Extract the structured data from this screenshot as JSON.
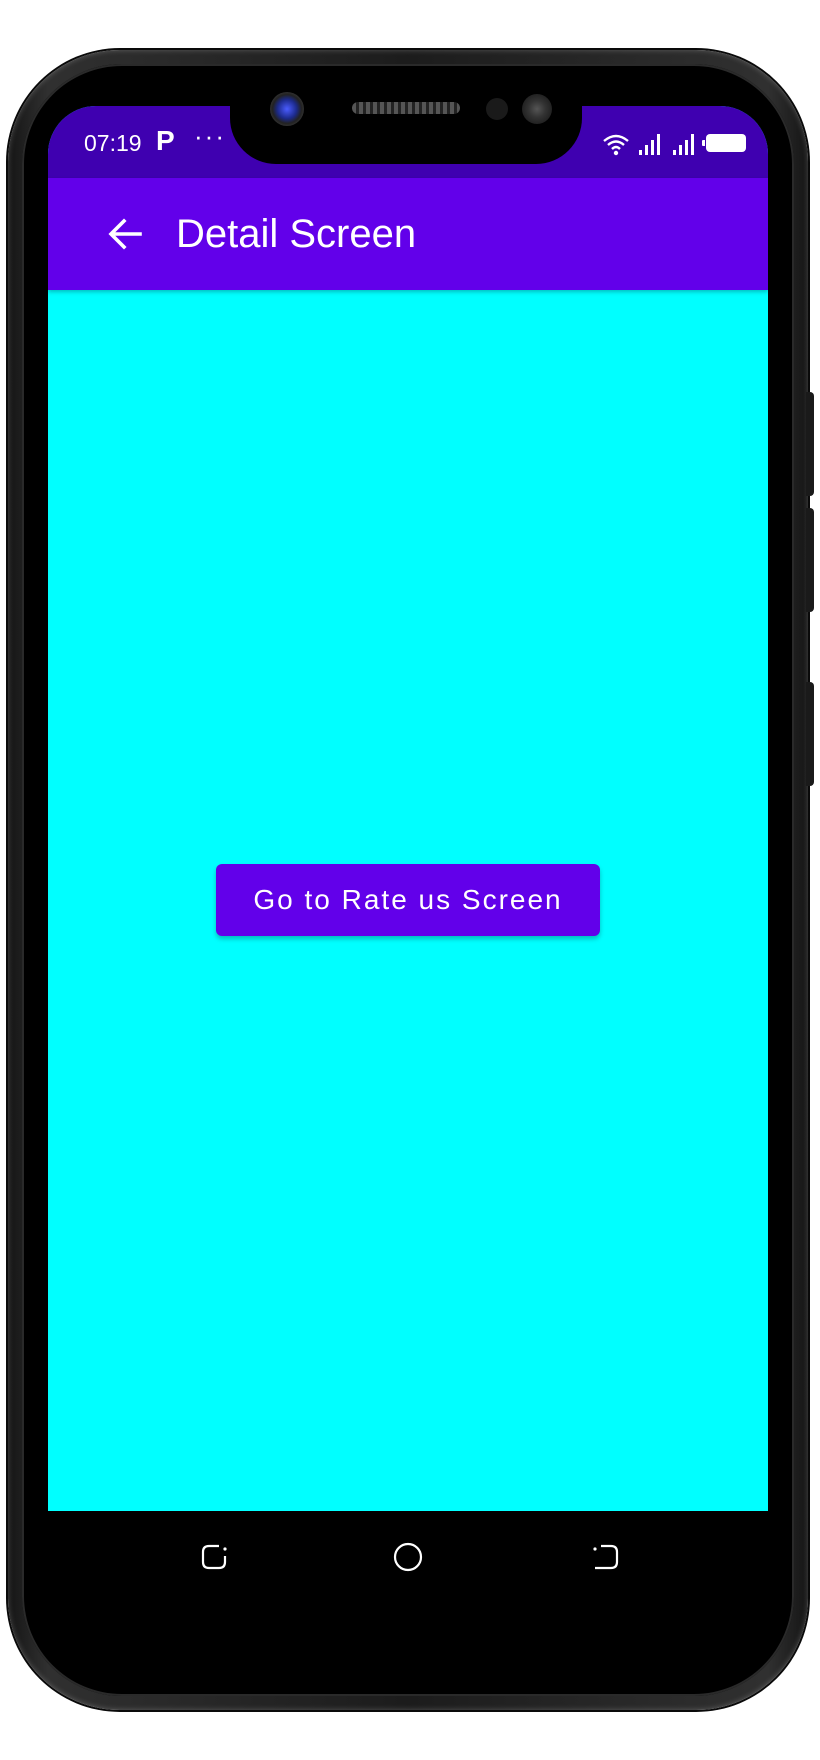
{
  "status_bar": {
    "time": "07:19",
    "notification_icon_letter": "P",
    "overflow_dots": "···",
    "icons": [
      "wifi-icon",
      "signal-icon",
      "signal-icon",
      "battery-icon"
    ]
  },
  "app_bar": {
    "title": "Detail Screen",
    "back_icon": "arrow-left-icon"
  },
  "main": {
    "button_label": "Go to Rate us Screen"
  },
  "nav_bar": {
    "icons": [
      "recents-icon",
      "home-icon",
      "back-icon"
    ]
  },
  "colors": {
    "status_bar": "#3f00b0",
    "app_bar": "#6200ea",
    "background": "#00ffff",
    "button": "#6200ea",
    "text_on_primary": "#ffffff"
  }
}
